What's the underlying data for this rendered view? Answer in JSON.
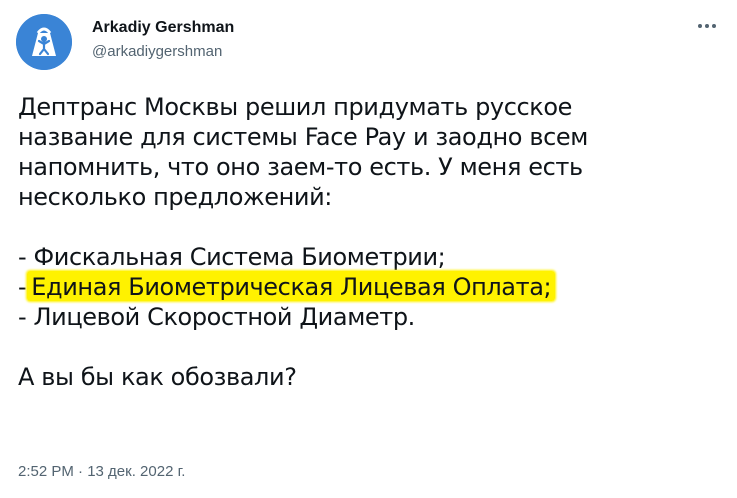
{
  "author": {
    "name": "Arkadiy Gershman",
    "handle": "@arkadiygershman",
    "avatar_color": "#3a84d6"
  },
  "menu": {
    "icon": "more-horizontal-icon"
  },
  "tweet": {
    "paragraph1_line1": "Дептранс Москвы решил придумать русское",
    "paragraph1_line2": "название для системы Face Pay и заодно всем",
    "paragraph1_line3": "напомнить, что оно заем-то есть. У меня есть",
    "paragraph1_line4": "несколько предложений:",
    "list": [
      {
        "prefix": "- ",
        "text": "Фискальная Система Биометрии;"
      },
      {
        "prefix": "-",
        "text": "Единая Биометрическая Лицевая Оплата;",
        "highlight_color": "#fff200"
      },
      {
        "prefix": "- ",
        "text": "Лицевой Скоростной Диаметр."
      }
    ],
    "closing": "А вы бы как обозвали?"
  },
  "timestamp": "2:52 PM · 13 дек. 2022 г."
}
